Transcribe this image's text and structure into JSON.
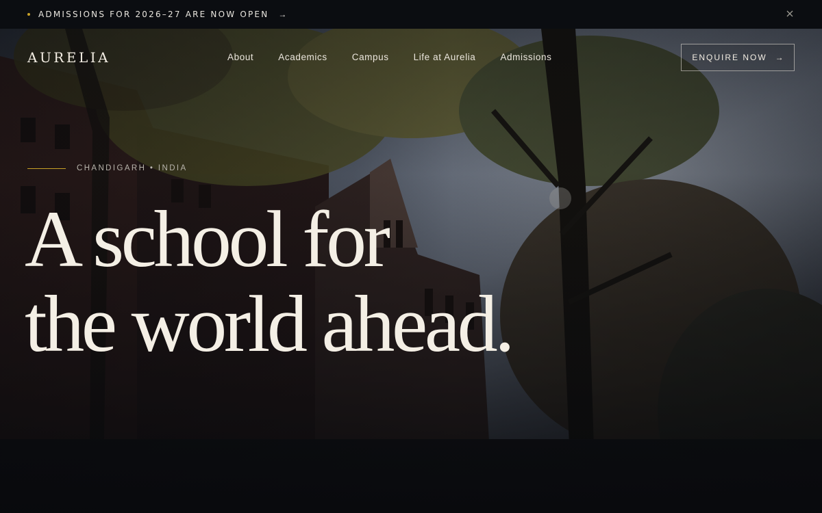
{
  "announcement": {
    "text": "ADMISSIONS FOR 2026–27 ARE NOW OPEN",
    "arrow_icon": "arrow-right-icon",
    "close_icon": "close-icon",
    "accent": "#c9a227"
  },
  "nav": {
    "logo": "AURELIA",
    "items": [
      {
        "label": "About"
      },
      {
        "label": "Academics"
      },
      {
        "label": "Campus"
      },
      {
        "label": "Life at Aurelia"
      },
      {
        "label": "Admissions"
      }
    ],
    "cta_label": "ENQUIRE NOW",
    "cta_icon": "arrow-right-icon"
  },
  "hero": {
    "eyebrow": "CHANDIGARH • INDIA",
    "headline_line1": "A school for",
    "headline_line2": "the world ahead."
  }
}
